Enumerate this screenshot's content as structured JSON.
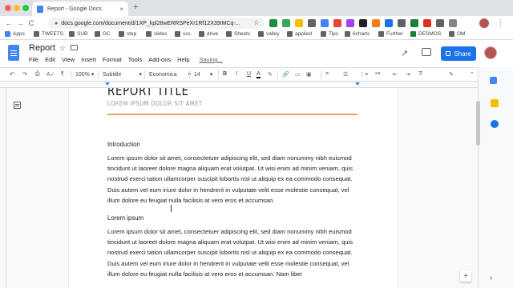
{
  "browser": {
    "tab_title": "Report - Google Docs",
    "tab_close": "×",
    "new_tab": "+",
    "url": "docs.google.com/document/d/1XP_kpl28wERRSPeXr1Rf12X39IMCq-...",
    "nav_back": "←",
    "nav_forward": "→",
    "nav_reload": "C",
    "bookmark_star": "☆"
  },
  "bookmarks": [
    "Apps",
    "TWEETS",
    "SUB",
    "GC",
    "step",
    "slides",
    "sss",
    "drive",
    "Sheets",
    "valley",
    "applied",
    "Tips",
    "6charts",
    "Further",
    "DESMOS",
    "OM"
  ],
  "docs": {
    "title": "Report",
    "star": "☆",
    "menu": [
      "File",
      "Edit",
      "View",
      "Insert",
      "Format",
      "Tools",
      "Add-ons",
      "Help"
    ],
    "saving": "Saving...",
    "share_label": "Share",
    "trend_icon": "↗"
  },
  "toolbar": {
    "undo": "↶",
    "redo": "↷",
    "print": "⎙",
    "zoom": "100%",
    "style": "Subtitle",
    "font": "Economica",
    "size": "14",
    "bold": "B",
    "italic": "I",
    "underline": "U",
    "text_color": "A",
    "dropdown_arrow": "▾",
    "more": "⋮",
    "collapse": "⌃"
  },
  "document": {
    "title": "REPORT TITLE",
    "subtitle": "LOREM IPSUM DOLOR SIT AMET",
    "heading1": "Introduction",
    "para1": "Lorem ipsum dolor sit amet, consectetuer adipiscing elit, sed diam nonummy nibh euismod tincidunt ut laoreet dolore magna aliquam erat volutpat. Ut wisi enim ad minim veniam, quis nostrud exerci tation ullamcorper suscipit lobortis nisl ut aliquip ex ea commodo consequat. Duis autem vel eum iriure dolor in hendrerit in vulputate velit esse molestie consequat, vel illum dolore eu feugiat nulla facilisis at vero eros et accumsan.",
    "heading2": "Lorem ipsum",
    "para2": "Lorem ipsum dolor sit amet, consectetuer adipiscing elit, sed diam nonummy nibh euismod tincidunt ut laoreet dolore magna aliquam erat volutpat. Ut wisi enim ad minim veniam, quis nostrud exerci tation ullamcorper suscipit lobortis nisl ut aliquip ex ea commodo consequat. Duis autem vel eum iriure dolor in hendrerit in vulputate velit esse molestie consequat, vel illum dolore eu feugiat nulla facilisis at vero eros et accumsan. Nam liber"
  },
  "side": {
    "fab": "+",
    "expand": "›"
  },
  "colors": {
    "accent_blue": "#1a73e8",
    "rule_orange": "#e5a36b"
  }
}
